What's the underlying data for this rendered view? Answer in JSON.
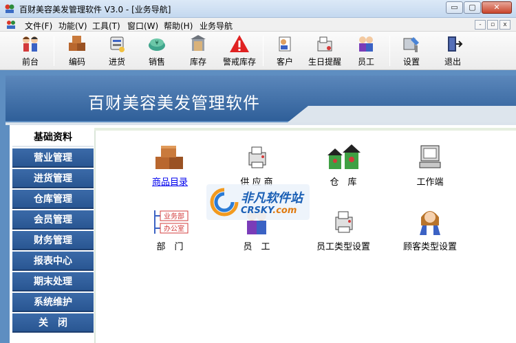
{
  "window": {
    "title": "百财美容美发管理软件 V3.0 - [业务导航]",
    "buttons": {
      "minimize": "▭",
      "maximize": "▢",
      "close": "✕"
    }
  },
  "menu": {
    "items": [
      "文件(F)",
      "功能(V)",
      "工具(T)",
      "窗口(W)",
      "帮助(H)",
      "业务导航"
    ],
    "mdi_buttons": [
      "-",
      "▫",
      "x"
    ]
  },
  "toolbar": {
    "buttons": [
      {
        "label": "前台",
        "icon": "people-icon"
      },
      {
        "label": "编码",
        "icon": "boxes-icon"
      },
      {
        "label": "进货",
        "icon": "purchase-icon"
      },
      {
        "label": "销售",
        "icon": "sales-icon"
      },
      {
        "label": "库存",
        "icon": "inventory-icon"
      },
      {
        "label": "警戒库存",
        "icon": "warning-icon"
      },
      {
        "label": "客户",
        "icon": "customer-icon"
      },
      {
        "label": "生日提醒",
        "icon": "birthday-icon"
      },
      {
        "label": "员工",
        "icon": "staff-icon"
      },
      {
        "label": "设置",
        "icon": "settings-icon"
      },
      {
        "label": "退出",
        "icon": "exit-icon"
      }
    ]
  },
  "banner": {
    "title": "百财美容美发管理软件"
  },
  "nav": {
    "items": [
      "基础资料",
      "营业管理",
      "进货管理",
      "仓库管理",
      "会员管理",
      "财务管理",
      "报表中心",
      "期末处理",
      "系统维护",
      "关　闭"
    ],
    "active": "基础资料"
  },
  "modules": {
    "items": [
      {
        "label": "商品目录",
        "icon": "boxes-icon",
        "link": true
      },
      {
        "label": "供 应 商",
        "icon": "printer-icon",
        "link": false
      },
      {
        "label": "仓　库",
        "icon": "warehouse-icon",
        "link": false
      },
      {
        "label": "工作端",
        "icon": "computer-icon",
        "link": false
      },
      {
        "label": "部　门",
        "icon": "org-chart-icon",
        "link": false
      },
      {
        "label": "员　工",
        "icon": "staff-icon",
        "link": false
      },
      {
        "label": "员工类型设置",
        "icon": "printer-icon",
        "link": false
      },
      {
        "label": "顾客类型设置",
        "icon": "customer-girl-icon",
        "link": false
      }
    ],
    "dept_chart": {
      "top": "业务部",
      "bottom": "办公室"
    }
  },
  "watermark": {
    "title": "非凡软件站",
    "sub": "CRSKY",
    "domain": ".com"
  },
  "colors": {
    "nav_blue": "#2f5f99",
    "banner_blue": "#3f6ea8",
    "link": "#0000ee",
    "close_red": "#c9452b"
  }
}
